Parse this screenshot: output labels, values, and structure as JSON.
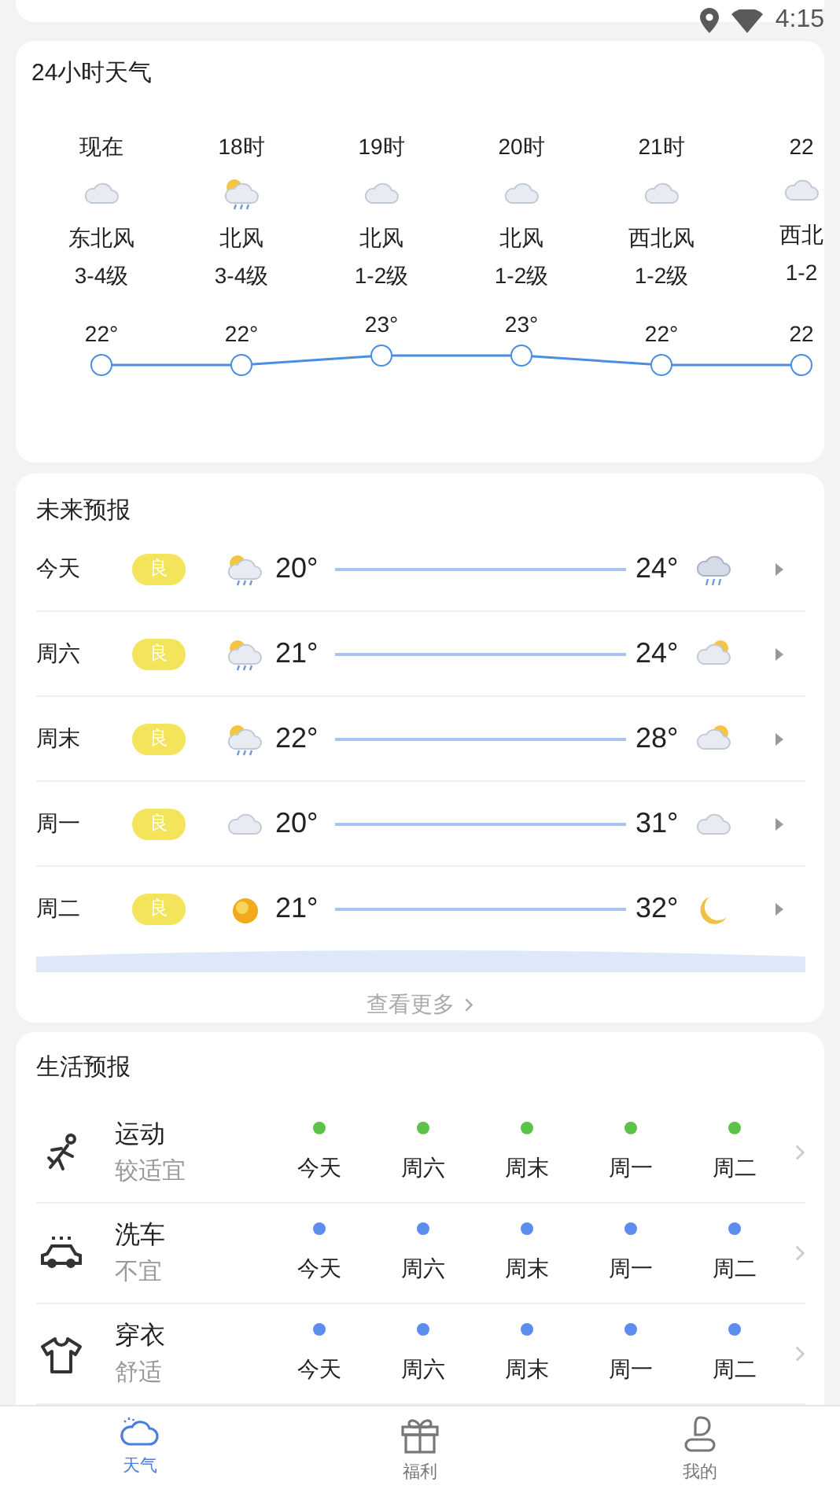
{
  "status_bar": {
    "time": "4:15"
  },
  "hourly": {
    "title": "24小时天气",
    "hours": [
      {
        "time": "现在",
        "icon": {
          "kind": "cloudy"
        },
        "wind": "东北风",
        "level": "3-4级"
      },
      {
        "time": "18时",
        "icon": {
          "kind": "sun-rain"
        },
        "wind": "北风",
        "level": "3-4级"
      },
      {
        "time": "19时",
        "icon": {
          "kind": "cloudy"
        },
        "wind": "北风",
        "level": "1-2级"
      },
      {
        "time": "20时",
        "icon": {
          "kind": "cloudy"
        },
        "wind": "北风",
        "level": "1-2级"
      },
      {
        "time": "21时",
        "icon": {
          "kind": "cloudy"
        },
        "wind": "西北风",
        "level": "1-2级"
      },
      {
        "time": "22",
        "icon": {
          "kind": "cloudy"
        },
        "wind": "西北",
        "level": "1-2"
      }
    ],
    "chart_data": {
      "type": "line",
      "series": [
        {
          "color": "#4a8ee0",
          "marker": true,
          "values": [
            22,
            22,
            23,
            23,
            22,
            22
          ],
          "value_labels": [
            "22°",
            "22°",
            "23°",
            "23°",
            "22°",
            "22"
          ]
        }
      ]
    }
  },
  "forecast": {
    "title": "未来预报",
    "days": [
      {
        "day": "今天",
        "aqi": "良",
        "day_icon": {
          "kind": "sun-rain"
        },
        "low": "20°",
        "high": "24°",
        "night_icon": {
          "kind": "rain"
        }
      },
      {
        "day": "周六",
        "aqi": "良",
        "day_icon": {
          "kind": "sun-rain"
        },
        "low": "21°",
        "high": "24°",
        "night_icon": {
          "kind": "sun-cloud"
        }
      },
      {
        "day": "周末",
        "aqi": "良",
        "day_icon": {
          "kind": "sun-rain"
        },
        "low": "22°",
        "high": "28°",
        "night_icon": {
          "kind": "sun-cloud"
        }
      },
      {
        "day": "周一",
        "aqi": "良",
        "day_icon": {
          "kind": "cloudy"
        },
        "low": "20°",
        "high": "31°",
        "night_icon": {
          "kind": "cloudy"
        }
      },
      {
        "day": "周二",
        "aqi": "良",
        "day_icon": {
          "kind": "sunny"
        },
        "low": "21°",
        "high": "32°",
        "night_icon": {
          "kind": "moon"
        }
      }
    ],
    "more": "查看更多"
  },
  "life": {
    "title": "生活预报",
    "rows": [
      {
        "kind": "sport",
        "name": "运动",
        "advice": "较适宜",
        "color": "#5bc24a",
        "days": [
          "今天",
          "周六",
          "周末",
          "周一",
          "周二"
        ]
      },
      {
        "kind": "carwash",
        "name": "洗车",
        "advice": "不宜",
        "color": "#5b8def",
        "days": [
          "今天",
          "周六",
          "周末",
          "周一",
          "周二"
        ]
      },
      {
        "kind": "clothing",
        "name": "穿衣",
        "advice": "舒适",
        "color": "#5b8def",
        "days": [
          "今天",
          "周六",
          "周末",
          "周一",
          "周二"
        ]
      }
    ]
  },
  "nav": {
    "tabs": [
      {
        "kind": "weather",
        "label": "天气",
        "selected": true
      },
      {
        "kind": "gift",
        "label": "福利",
        "selected": false
      },
      {
        "kind": "profile",
        "label": "我的",
        "selected": false
      }
    ]
  }
}
